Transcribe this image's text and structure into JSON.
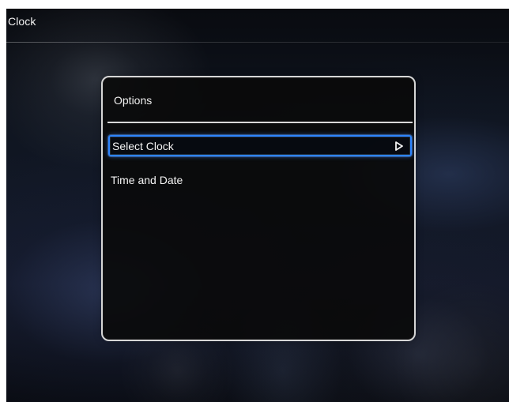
{
  "header": {
    "title": "Clock"
  },
  "options_panel": {
    "title": "Options",
    "items": [
      {
        "label": "Select Clock",
        "selected": true,
        "icon": "triangle-right-icon"
      },
      {
        "label": "Time and Date",
        "selected": false
      }
    ]
  },
  "colors": {
    "selection_border": "#2d84ff",
    "panel_border": "#d6d6d6",
    "text": "#f2f2f2"
  }
}
